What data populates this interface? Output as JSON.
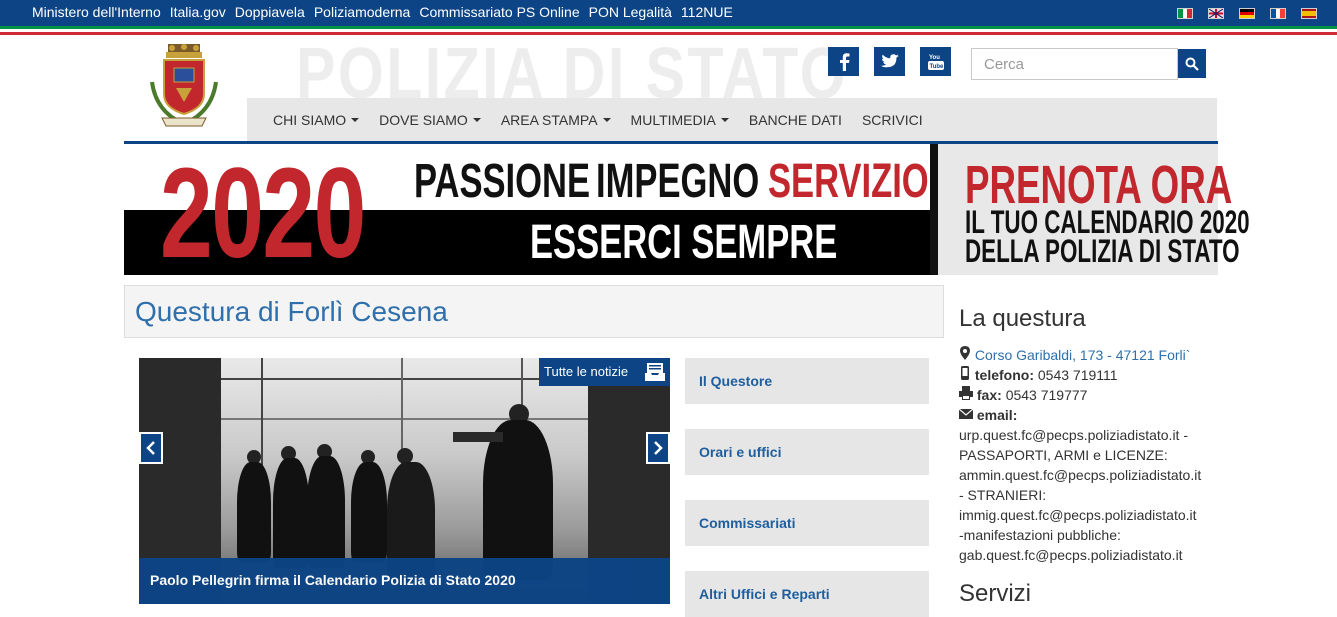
{
  "topbar": {
    "links": [
      "Ministero dell'Interno",
      "Italia.gov",
      "Doppiavela",
      "Poliziamoderna",
      "Commissariato PS Online",
      "PON Legalità",
      "112NUE"
    ],
    "flags": [
      "italian-flag",
      "english-flag",
      "german-flag",
      "french-flag",
      "spanish-flag"
    ]
  },
  "header": {
    "brand": "POLIZIA DI STATO",
    "search_placeholder": "Cerca",
    "social": [
      "facebook-icon",
      "twitter-icon",
      "youtube-icon"
    ]
  },
  "nav": {
    "items": [
      {
        "label": "CHI SIAMO",
        "dropdown": true
      },
      {
        "label": "DOVE SIAMO",
        "dropdown": true
      },
      {
        "label": "AREA STAMPA",
        "dropdown": true
      },
      {
        "label": "MULTIMEDIA",
        "dropdown": true
      },
      {
        "label": "BANCHE DATI",
        "dropdown": false
      },
      {
        "label": "SCRIVICI",
        "dropdown": false
      }
    ]
  },
  "banner": {
    "year": "2020",
    "word1": "PASSIONE",
    "word2": "IMPEGNO",
    "word3": "SERVIZIO",
    "tagline": "ESSERCI SEMPRE",
    "cta_title": "PRENOTA ORA",
    "cta_line1": "IL TUO CALENDARIO 2020",
    "cta_line2": "DELLA POLIZIA DI STATO"
  },
  "main": {
    "title": "Questura di Forlì Cesena",
    "tutte_le_notizie": "Tutte le notizie",
    "caption": "Paolo Pellegrin firma il Calendario Polizia di Stato 2020",
    "side_buttons": [
      "Il Questore",
      "Orari e uffici",
      "Commissariati",
      "Altri Uffici e Reparti"
    ]
  },
  "questura": {
    "title": "La questura",
    "address": "Corso Garibaldi, 173 - 47121 Forli`",
    "telefono_label": "telefono:",
    "telefono": "0543 719111",
    "fax_label": "fax:",
    "fax": "0543 719777",
    "email_label": "email:",
    "email_lines": [
      "urp.quest.fc@pecps.poliziadistato.it -",
      "PASSAPORTI, ARMI e LICENZE:",
      "ammin.quest.fc@pecps.poliziadistato.it",
      "- STRANIERI:",
      "immig.quest.fc@pecps.poliziadistato.it",
      "-manifestazioni pubbliche:",
      "gab.quest.fc@pecps.poliziadistato.it"
    ],
    "servizi_title": "Servizi"
  },
  "colors": {
    "primary_blue": "#0d4485",
    "link_blue": "#2f6fab",
    "banner_red": "#c1272d",
    "italy_green": "#009246",
    "italy_red": "#ce2b37"
  }
}
